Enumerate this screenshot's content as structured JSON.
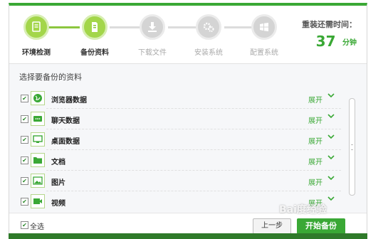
{
  "steps": [
    {
      "label": "环境检测",
      "icon": "monitor-icon"
    },
    {
      "label": "备份资料",
      "icon": "document-icon"
    },
    {
      "label": "下载文件",
      "icon": "download-icon"
    },
    {
      "label": "安装系统",
      "icon": "gears-icon"
    },
    {
      "label": "配置系统",
      "icon": "windows-icon"
    }
  ],
  "time": {
    "title": "重装还需时间：",
    "value": "37",
    "unit": "分钟"
  },
  "section_title": "选择要备份的资料",
  "items": [
    {
      "name": "浏览器数据",
      "icon": "globe-icon",
      "checked": "✔",
      "expand": "展开"
    },
    {
      "name": "聊天数据",
      "icon": "chat-icon",
      "checked": "✔",
      "expand": "展开"
    },
    {
      "name": "桌面数据",
      "icon": "desktop-icon",
      "checked": "✔",
      "expand": "展开"
    },
    {
      "name": "文档",
      "icon": "folder-icon",
      "checked": "✔",
      "expand": "展开"
    },
    {
      "name": "图片",
      "icon": "picture-icon",
      "checked": "✔",
      "expand": "展开"
    },
    {
      "name": "视频",
      "icon": "video-icon",
      "checked": "✔",
      "expand": "展开"
    }
  ],
  "footer": {
    "select_all": "全选",
    "select_all_checked": "✔",
    "prev": "上一步",
    "next": "开始备份"
  },
  "watermark": "Bai度经验",
  "colors": {
    "accent": "#3aa835",
    "light_green": "#a3d64a",
    "inactive": "#d4d4d4"
  }
}
